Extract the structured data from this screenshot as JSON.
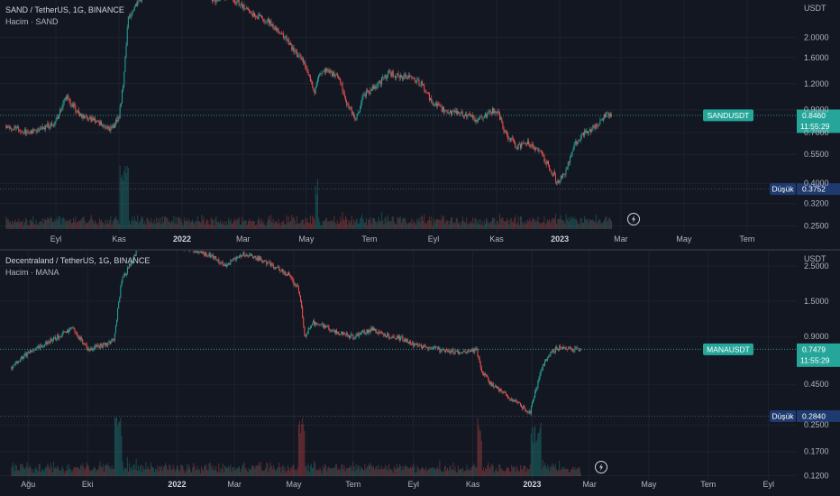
{
  "chart_data": [
    {
      "type": "line",
      "title": "SAND / TetherUS, 1G, BINANCE",
      "volume_label": "Hacim · SAND",
      "currency_label": "USDT",
      "y_scale": "log",
      "yticks": [
        2.0,
        1.6,
        1.2,
        0.9,
        0.7,
        0.55,
        0.4,
        0.32,
        0.25
      ],
      "ytick_labels": [
        "2.0000",
        "1.6000",
        "1.2000",
        "0.9000",
        "0.7000",
        "0.5500",
        "0.4000",
        "0.3200",
        "0.2500"
      ],
      "date_labels": [
        {
          "label": "Eyl",
          "year": false
        },
        {
          "label": "Kas",
          "year": false
        },
        {
          "label": "2022",
          "year": true
        },
        {
          "label": "Mar",
          "year": false
        },
        {
          "label": "May",
          "year": false
        },
        {
          "label": "Tem",
          "year": false
        },
        {
          "label": "Eyl",
          "year": false
        },
        {
          "label": "Kas",
          "year": false
        },
        {
          "label": "2023",
          "year": true
        },
        {
          "label": "Mar",
          "year": false
        },
        {
          "label": "May",
          "year": false
        },
        {
          "label": "Tem",
          "year": false
        }
      ],
      "series": [
        {
          "x": [
            "2021-07-15",
            "2021-08-01",
            "2021-08-15",
            "2021-09-01",
            "2021-09-10",
            "2021-09-25",
            "2021-10-10",
            "2021-10-25",
            "2021-11-01",
            "2021-11-05",
            "2021-11-10",
            "2021-11-25",
            "2022-01-15",
            "2022-02-01",
            "2022-02-15",
            "2022-03-01",
            "2022-03-10",
            "2022-03-25",
            "2022-04-10",
            "2022-04-20",
            "2022-05-01",
            "2022-05-09",
            "2022-05-12",
            "2022-05-20",
            "2022-06-01",
            "2022-06-10",
            "2022-06-18",
            "2022-06-25",
            "2022-07-10",
            "2022-07-20",
            "2022-07-28",
            "2022-08-10",
            "2022-08-20",
            "2022-09-01",
            "2022-09-15",
            "2022-10-01",
            "2022-10-15",
            "2022-10-28",
            "2022-11-03",
            "2022-11-09",
            "2022-11-20",
            "2022-12-01",
            "2022-12-10",
            "2022-12-20",
            "2022-12-30",
            "2023-01-05",
            "2023-01-15",
            "2023-01-25",
            "2023-02-01",
            "2023-02-08",
            "2023-02-15",
            "2023-02-20"
          ],
          "close": [
            0.76,
            0.7,
            0.73,
            0.78,
            1.05,
            0.85,
            0.78,
            0.73,
            0.82,
            1.2,
            2.5,
            3.2,
            3.5,
            3.0,
            3.2,
            2.8,
            2.6,
            2.4,
            2.0,
            1.7,
            1.45,
            1.1,
            1.3,
            1.4,
            1.3,
            0.95,
            0.8,
            1.05,
            1.2,
            1.35,
            1.3,
            1.3,
            1.2,
            0.95,
            0.88,
            0.85,
            0.8,
            0.9,
            0.85,
            0.7,
            0.6,
            0.62,
            0.58,
            0.5,
            0.4,
            0.44,
            0.6,
            0.7,
            0.73,
            0.78,
            0.85,
            0.846
          ]
        }
      ],
      "last_price": {
        "symbol": "SANDUSDT",
        "value": "0.8460",
        "countdown": "11:55:29"
      },
      "low": {
        "label": "Düşük",
        "value": "0.3752"
      }
    },
    {
      "type": "line",
      "title": "Decentraland / TetherUS, 1G, BINANCE",
      "volume_label": "Hacim · MANA",
      "currency_label": "USDT",
      "y_scale": "log",
      "yticks": [
        2.5,
        1.5,
        0.9,
        0.45,
        0.25,
        0.17,
        0.12
      ],
      "ytick_labels": [
        "2.5000",
        "1.5000",
        "0.9000",
        "0.4500",
        "0.2500",
        "0.1700",
        "0.1200"
      ],
      "date_labels": [
        {
          "label": "Ağu",
          "year": false
        },
        {
          "label": "Eki",
          "year": false
        },
        {
          "label": "2022",
          "year": true
        },
        {
          "label": "Mar",
          "year": false
        },
        {
          "label": "May",
          "year": false
        },
        {
          "label": "Tem",
          "year": false
        },
        {
          "label": "Eyl",
          "year": false
        },
        {
          "label": "Kas",
          "year": false
        },
        {
          "label": "2023",
          "year": true
        },
        {
          "label": "Mar",
          "year": false
        },
        {
          "label": "May",
          "year": false
        },
        {
          "label": "Tem",
          "year": false
        },
        {
          "label": "Eyl",
          "year": false
        }
      ],
      "series": [
        {
          "x": [
            "2021-07-15",
            "2021-08-01",
            "2021-08-15",
            "2021-09-01",
            "2021-09-15",
            "2021-10-01",
            "2021-10-20",
            "2021-10-28",
            "2021-11-05",
            "2021-11-25",
            "2021-12-10",
            "2022-01-01",
            "2022-01-20",
            "2022-02-05",
            "2022-02-20",
            "2022-03-10",
            "2022-03-25",
            "2022-04-10",
            "2022-04-25",
            "2022-05-05",
            "2022-05-09",
            "2022-05-12",
            "2022-05-20",
            "2022-06-01",
            "2022-06-15",
            "2022-07-01",
            "2022-07-20",
            "2022-08-01",
            "2022-08-20",
            "2022-09-01",
            "2022-09-20",
            "2022-10-10",
            "2022-10-25",
            "2022-11-05",
            "2022-11-10",
            "2022-11-20",
            "2022-12-01",
            "2022-12-20",
            "2022-12-30",
            "2023-01-10",
            "2023-01-20",
            "2023-02-01",
            "2023-02-10",
            "2023-02-20"
          ],
          "close": [
            0.58,
            0.72,
            0.8,
            0.9,
            1.02,
            0.75,
            0.8,
            0.86,
            2.0,
            3.5,
            3.8,
            3.4,
            3.1,
            2.9,
            2.5,
            3.0,
            2.8,
            2.5,
            2.2,
            1.8,
            1.4,
            0.9,
            1.1,
            1.05,
            0.95,
            0.9,
            1.0,
            0.92,
            0.87,
            0.8,
            0.76,
            0.72,
            0.72,
            0.74,
            0.55,
            0.45,
            0.4,
            0.33,
            0.3,
            0.55,
            0.72,
            0.78,
            0.74,
            0.7479
          ]
        }
      ],
      "last_price": {
        "symbol": "MANAUSDT",
        "value": "0.7479",
        "countdown": "11:55:29"
      },
      "low": {
        "label": "Düşük",
        "value": "0.2840"
      }
    }
  ],
  "colors": {
    "background": "#131722",
    "up": "#26a69a",
    "down": "#ef5350",
    "grid": "#1e222d",
    "price_tag": "#26a69a",
    "low_tag": "#1e3a6e"
  },
  "icons": {
    "replay": "lightning-icon"
  }
}
